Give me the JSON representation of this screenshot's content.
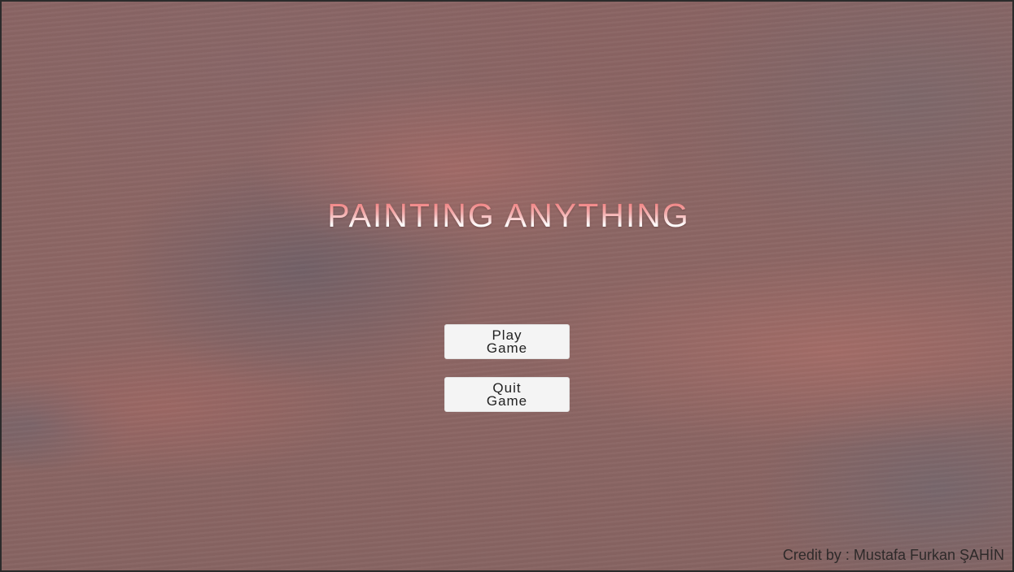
{
  "game": {
    "title": "PAINTING ANYTHING",
    "buttons": {
      "play_label": "Play Game",
      "quit_label": "Quit Game"
    },
    "credit": "Credit by : Mustafa Furkan ŞAHİN"
  },
  "colors": {
    "background": "#8c6664",
    "title_top": "#f06a6a",
    "title_bottom": "#ffffff",
    "button_bg": "#f4f4f4",
    "button_text": "#222222"
  }
}
